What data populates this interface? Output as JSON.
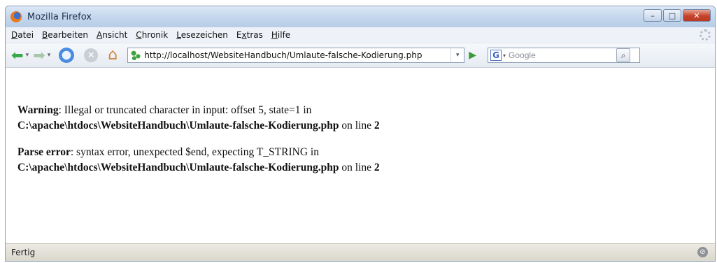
{
  "window": {
    "title": "Mozilla Firefox",
    "controls": {
      "minimize": "–",
      "maximize": "□",
      "close": "✕"
    }
  },
  "menubar": {
    "items": [
      {
        "hotkey": "D",
        "rest": "atei"
      },
      {
        "hotkey": "B",
        "rest": "earbeiten"
      },
      {
        "hotkey": "A",
        "rest": "nsicht"
      },
      {
        "hotkey": "C",
        "rest": "hronik"
      },
      {
        "hotkey": "L",
        "rest": "esezeichen"
      },
      {
        "pre": "E",
        "hotkey": "x",
        "rest": "tras"
      },
      {
        "hotkey": "H",
        "rest": "ilfe"
      }
    ]
  },
  "navbar": {
    "back_glyph": "⬅",
    "forward_glyph": "➡",
    "dropdown_glyph": "▾",
    "reload_glyph": "↻",
    "stop_glyph": "✕",
    "home_glyph": "⌂",
    "go_glyph": "▶",
    "url": "http://localhost/WebsiteHandbuch/Umlaute-falsche-Kodierung.php",
    "search_engine_letter": "G",
    "search_placeholder": "Google",
    "search_glyph": "⌕"
  },
  "content": {
    "warning": {
      "label": "Warning",
      "text": ": Illegal or truncated character in input: offset 5, state=1 in",
      "path": "C:\\apache\\htdocs\\WebsiteHandbuch\\Umlaute-falsche-Kodierung.php",
      "on_line": " on line ",
      "line": "2"
    },
    "parse_error": {
      "label": "Parse error",
      "text": ": syntax error, unexpected $end, expecting T_STRING in",
      "path": "C:\\apache\\htdocs\\WebsiteHandbuch\\Umlaute-falsche-Kodierung.php",
      "on_line": " on line ",
      "line": "2"
    }
  },
  "statusbar": {
    "text": "Fertig",
    "icon_glyph": "⊘"
  }
}
